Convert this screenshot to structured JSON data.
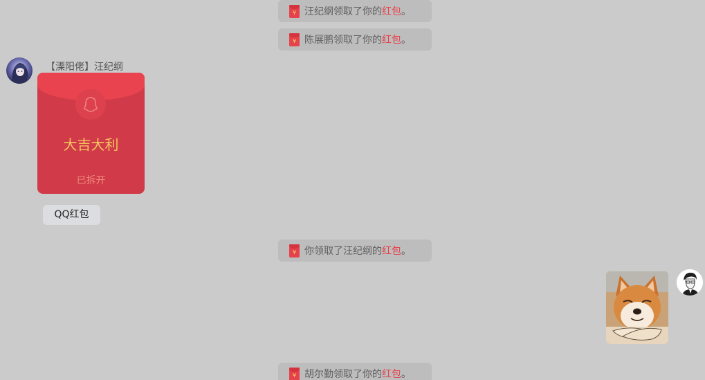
{
  "notices": [
    {
      "prefix": "汪纪纲领取了你的",
      "link": "红包",
      "suffix": "。"
    },
    {
      "prefix": "陈展鹏领取了你的",
      "link": "红包",
      "suffix": "。"
    },
    {
      "prefix": "你领取了汪纪纲的",
      "link": "红包",
      "suffix": "。"
    },
    {
      "prefix": "胡尔勤领取了你的",
      "link": "红包",
      "suffix": "。"
    }
  ],
  "notice_icon_symbol": "¥",
  "sender": {
    "name": "【溧阳佬】汪纪纲"
  },
  "red_packet": {
    "greeting": "大吉大利",
    "status": "已拆开",
    "label": "QQ红包"
  },
  "sent_image": {
    "subject": "shiba-inu-arms-crossed"
  },
  "colors": {
    "background": "#cbcbcb",
    "notice_background": "#bdbdbd",
    "link_red": "#e8414b",
    "packet_red": "#d13a48",
    "packet_gold": "#f5c65e"
  }
}
